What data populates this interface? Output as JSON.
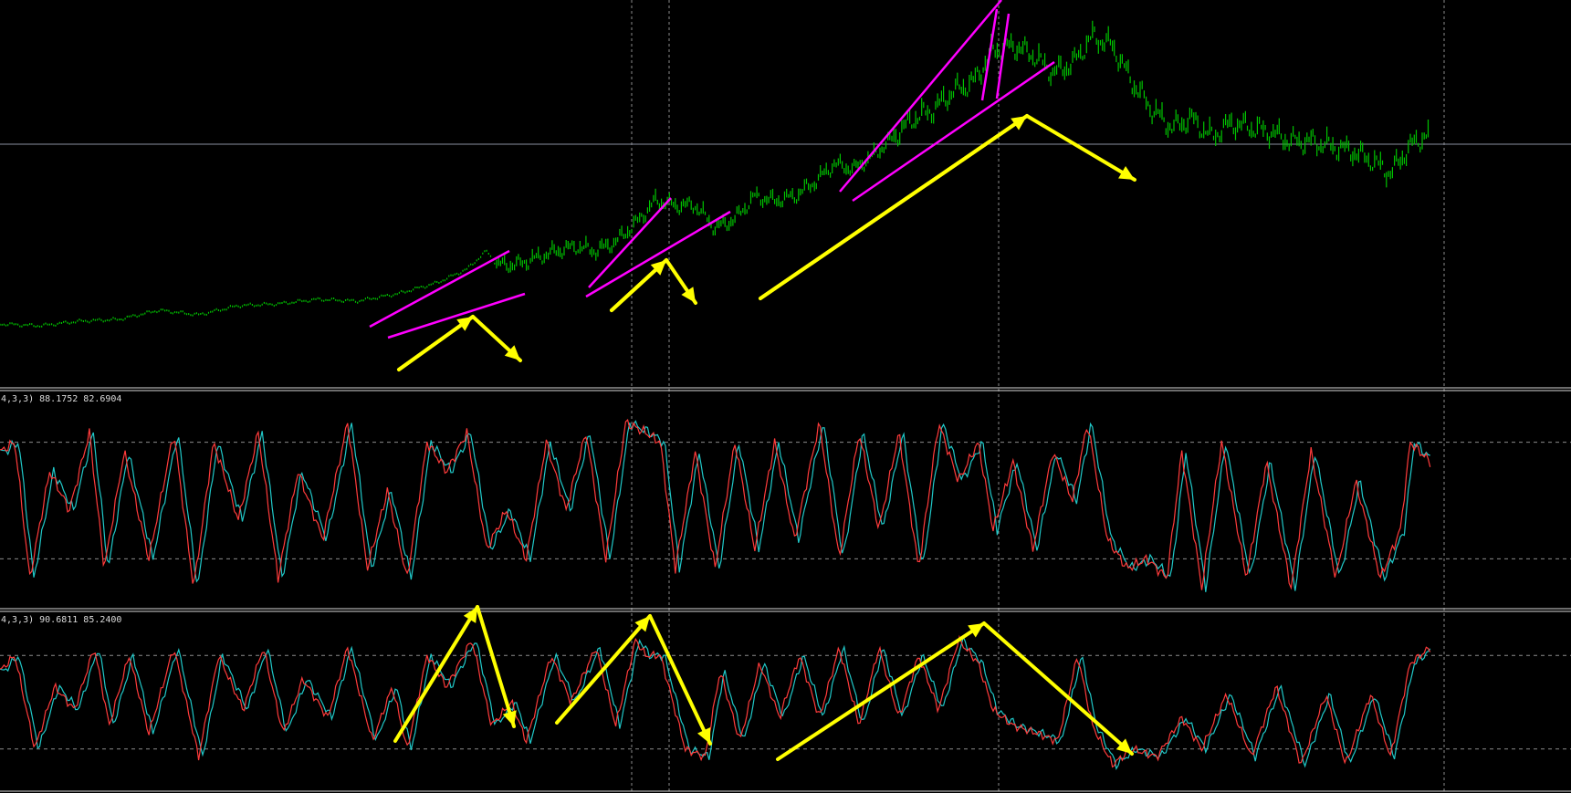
{
  "app": {
    "colors": {
      "background": "#000000",
      "price_bars": "#00c400",
      "trendlines": "#ff00ff",
      "arrows": "#ffff00",
      "stoch_main": "#ff3b3b",
      "stoch_signal": "#20c8c8",
      "grid": "#8a8a8a",
      "separator": "#d8d8d8",
      "price_line": "#8a8fa0"
    }
  },
  "panes": [
    {
      "id": "price",
      "label": ""
    },
    {
      "id": "stoch1",
      "label": "4,3,3) 88.1752 82.6904"
    },
    {
      "id": "stoch2",
      "label": "4,3,3) 90.6811 85.2400"
    }
  ],
  "chart_data": [
    {
      "type": "line",
      "pane": "price",
      "series": [
        {
          "x": [
            0,
            40,
            80,
            120,
            160,
            200,
            240,
            280,
            320,
            360,
            400,
            440,
            470,
            490,
            500,
            520,
            540,
            560,
            580,
            600,
            620,
            640,
            660,
            680,
            700,
            720,
            740,
            760,
            780,
            800,
            820,
            840,
            860,
            880,
            900,
            920,
            940,
            960,
            980,
            1000,
            1020,
            1040,
            1060,
            1080,
            1100,
            1120,
            1140,
            1160,
            1180,
            1200,
            1220,
            1240,
            1260,
            1280,
            1300,
            1320,
            1340,
            1360,
            1380,
            1400,
            1420,
            1440
          ],
          "values": [
            355,
            357,
            352,
            350,
            340,
            345,
            335,
            333,
            328,
            330,
            322,
            310,
            295,
            275,
            290,
            290,
            283,
            275,
            270,
            275,
            265,
            245,
            220,
            225,
            225,
            250,
            240,
            215,
            220,
            215,
            200,
            180,
            185,
            170,
            150,
            130,
            120,
            100,
            90,
            55,
            50,
            60,
            80,
            70,
            40,
            50,
            90,
            120,
            140,
            130,
            150,
            135,
            140,
            145,
            155,
            155,
            160,
            165,
            175,
            190,
            160,
            145
          ]
        }
      ]
    },
    {
      "type": "line",
      "pane": "stoch1",
      "ylim": [
        0,
        100
      ],
      "levels": [
        80,
        20
      ],
      "series": [
        {
          "x": [
            0,
            15,
            30,
            50,
            70,
            90,
            105,
            125,
            150,
            175,
            195,
            215,
            240,
            260,
            280,
            300,
            325,
            350,
            370,
            390,
            410,
            430,
            450,
            470,
            490,
            510,
            530,
            550,
            570,
            590,
            610,
            630,
            650,
            665,
            680,
            700,
            720,
            740,
            760,
            780,
            800,
            825,
            845,
            865,
            885,
            905,
            925,
            945,
            965,
            985,
            1000,
            1020,
            1040,
            1060,
            1080,
            1095,
            1115,
            1135,
            1155,
            1175,
            1190,
            1210,
            1230,
            1255,
            1275,
            1300,
            1320,
            1345,
            1365,
            1390,
            1410,
            1420,
            1440
          ],
          "values": [
            75,
            80,
            10,
            65,
            45,
            85,
            15,
            75,
            20,
            85,
            5,
            80,
            40,
            85,
            10,
            65,
            30,
            90,
            15,
            55,
            10,
            80,
            65,
            85,
            25,
            45,
            20,
            80,
            45,
            85,
            20,
            90,
            85,
            80,
            15,
            75,
            15,
            80,
            25,
            80,
            30,
            90,
            20,
            85,
            35,
            85,
            15,
            90,
            60,
            80,
            35,
            70,
            25,
            75,
            50,
            90,
            30,
            15,
            20,
            10,
            75,
            5,
            80,
            10,
            70,
            5,
            75,
            10,
            60,
            10,
            35,
            80,
            70
          ]
        }
      ]
    },
    {
      "type": "line",
      "pane": "stoch2",
      "ylim": [
        0,
        100
      ],
      "levels": [
        80,
        20
      ],
      "series": [
        {
          "x": [
            0,
            15,
            35,
            55,
            75,
            95,
            110,
            130,
            150,
            175,
            200,
            220,
            245,
            265,
            285,
            305,
            330,
            350,
            375,
            395,
            410,
            430,
            450,
            475,
            495,
            515,
            530,
            555,
            575,
            600,
            620,
            640,
            650,
            665,
            690,
            710,
            725,
            745,
            765,
            785,
            805,
            825,
            845,
            865,
            885,
            905,
            925,
            945,
            965,
            985,
            1000,
            1020,
            1045,
            1065,
            1085,
            1100,
            1120,
            1140,
            1165,
            1190,
            1210,
            1235,
            1260,
            1285,
            1310,
            1335,
            1355,
            1380,
            1400,
            1420,
            1440
          ],
          "values": [
            70,
            80,
            20,
            60,
            45,
            85,
            35,
            80,
            30,
            85,
            15,
            80,
            45,
            85,
            30,
            65,
            40,
            85,
            25,
            60,
            20,
            80,
            60,
            90,
            35,
            50,
            25,
            80,
            50,
            85,
            35,
            90,
            80,
            80,
            20,
            15,
            70,
            25,
            75,
            40,
            80,
            40,
            85,
            35,
            85,
            40,
            80,
            45,
            90,
            75,
            45,
            35,
            30,
            25,
            80,
            35,
            10,
            20,
            15,
            40,
            20,
            55,
            15,
            60,
            10,
            55,
            10,
            55,
            15,
            75,
            85
          ]
        }
      ]
    }
  ]
}
